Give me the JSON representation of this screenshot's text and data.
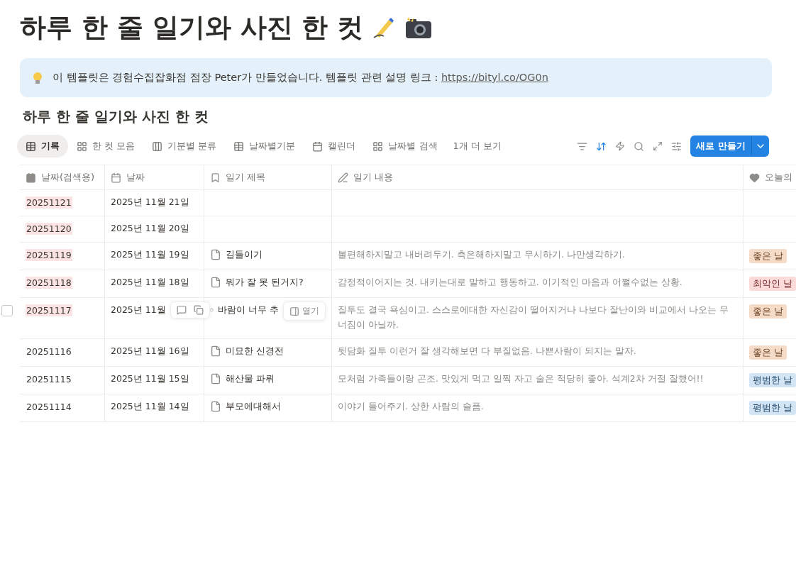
{
  "page_title": "하루 한 줄 일기와 사진 한 컷",
  "callout": {
    "text": "이 템플릿은 경험수집잡화점 점장 Peter가 만들었습니다. 템플릿 관련 설명 링크 : ",
    "link": "https://bityl.co/OG0n"
  },
  "database_title": "하루 한 줄 일기와 사진 한 컷",
  "tabs": [
    {
      "label": "기록",
      "selected": true
    },
    {
      "label": "한 컷 모음",
      "selected": false
    },
    {
      "label": "기분별 분류",
      "selected": false
    },
    {
      "label": "날짜별기분",
      "selected": false
    },
    {
      "label": "캘린더",
      "selected": false
    },
    {
      "label": "날짜별 검색",
      "selected": false
    }
  ],
  "more_views": "1개 더 보기",
  "new_button": "새로 만들기",
  "columns": [
    "날짜(검색용)",
    "날짜",
    "일기 제목",
    "일기 내용",
    "오늘의"
  ],
  "rows": [
    {
      "search_date": "20251121",
      "highlighted": true,
      "date": "2025년 11월 21일",
      "hovered": false
    },
    {
      "search_date": "20251120",
      "highlighted": true,
      "date": "2025년 11월 20일",
      "hovered": false
    },
    {
      "search_date": "20251119",
      "highlighted": true,
      "date": "2025년 11월 19일",
      "title": "길들이기",
      "content": "불편해하지말고 내버려두기. 측은해하지말고 무시하기. 나만생각하기.",
      "mood": {
        "label": "좋은 날",
        "color": "#f5dcc8"
      },
      "hovered": false
    },
    {
      "search_date": "20251118",
      "highlighted": true,
      "date": "2025년 11월 18일",
      "title": "뭐가 잘 못 된거지?",
      "content": "감정적이어지는 것. 내키는대로 말하고 행동하고. 이기적인 마음과 어쩔수없는 상황.",
      "mood": {
        "label": "최악인 날",
        "color": "#fbdada"
      },
      "hovered": false
    },
    {
      "search_date": "20251117",
      "highlighted": true,
      "date": "2025년 11월",
      "title": "바람이 너무 추",
      "open_label": "열기",
      "content": "질투도 결국 욕심이고. 스스로에대한 자신감이 떨어지거나 나보다 잘난이와 비교에서 나오는 무너짐이 아닐까.",
      "mood": {
        "label": "좋은 날",
        "color": "#f5dcc8"
      },
      "hovered": true
    },
    {
      "search_date": "20251116",
      "highlighted": false,
      "date": "2025년 11월 16일",
      "title": "미묘한 신경전",
      "content": "뒷담화 질투 이런거 잘 생각해보면 다 부질없음. 나쁜사람이 되지는 말자.",
      "mood": {
        "label": "좋은 날",
        "color": "#f5dcc8"
      },
      "hovered": false
    },
    {
      "search_date": "20251115",
      "highlighted": false,
      "date": "2025년 11월 15일",
      "title": "해산물 파뤼",
      "content": "모처럼 가족들이랑 곤조. 맛있게 먹고 일찍 자고 술은 적당히 좋아. 석계2차 거절 잘했어!!",
      "mood": {
        "label": "평범한 날",
        "color": "#d3e5f5"
      },
      "hovered": false
    },
    {
      "search_date": "20251114",
      "highlighted": false,
      "date": "2025년 11월 14일",
      "title": "부모에대해서",
      "content": "이야기 들어주기. 상한 사람의 슬픔.",
      "mood": {
        "label": "평범한 날",
        "color": "#d3e5f5"
      },
      "hovered": false
    }
  ]
}
